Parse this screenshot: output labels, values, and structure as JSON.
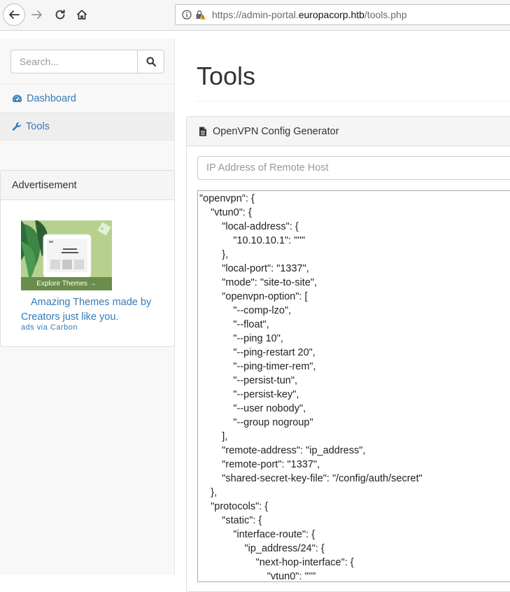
{
  "browser": {
    "url_prefix": "https://admin-portal.",
    "url_domain": "europacorp.htb",
    "url_path": "/tools.php",
    "icons": [
      "back-icon",
      "forward-icon",
      "reload-icon",
      "home-icon",
      "info-icon",
      "insecure-lock-icon"
    ]
  },
  "sidebar": {
    "search_placeholder": "Search...",
    "items": [
      {
        "label": "Dashboard",
        "icon": "dashboard-icon"
      },
      {
        "label": "Tools",
        "icon": "wrench-icon"
      }
    ],
    "advertisement": {
      "heading": "Advertisement",
      "image_button": "Explore Themes →",
      "text": "Amazing Themes made by Creators just like you.",
      "via": "ads via Carbon"
    }
  },
  "main": {
    "title": "Tools",
    "panel_title": "OpenVPN Config Generator",
    "ip_placeholder": "IP Address of Remote Host",
    "config_text": "\"openvpn\": {\n\t\"vtun0\": {\n\t\t\"local-address\": {\n\t\t\t\"10.10.10.1\": \"''\"\n\t\t},\n\t\t\"local-port\": \"1337\",\n\t\t\"mode\": \"site-to-site\",\n\t\t\"openvpn-option\": [\n\t\t\t\"--comp-lzo\",\n\t\t\t\"--float\",\n\t\t\t\"--ping 10\",\n\t\t\t\"--ping-restart 20\",\n\t\t\t\"--ping-timer-rem\",\n\t\t\t\"--persist-tun\",\n\t\t\t\"--persist-key\",\n\t\t\t\"--user nobody\",\n\t\t\t\"--group nogroup\"\n\t\t],\n\t\t\"remote-address\": \"ip_address\",\n\t\t\"remote-port\": \"1337\",\n\t\t\"shared-secret-key-file\": \"/config/auth/secret\"\n\t},\n\t\"protocols\": {\n\t\t\"static\": {\n\t\t\t\"interface-route\": {\n\t\t\t\t\"ip_address/24\": {\n\t\t\t\t\t\"next-hop-interface\": {\n\t\t\t\t\t\t\"vtun0\": \"''\""
  },
  "colors": {
    "link": "#337ab7",
    "warning": "#e8a317"
  }
}
